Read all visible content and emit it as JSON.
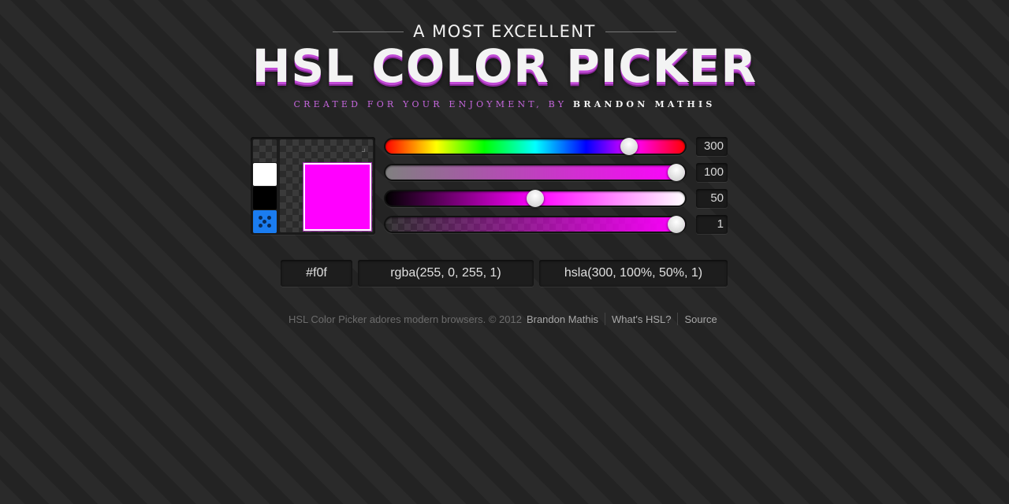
{
  "header": {
    "eyebrow": "A MOST EXCELLENT",
    "title": "HSL COLOR PICKER",
    "byline_lead": "CREATED FOR YOUR ENJOYMENT, BY",
    "byline_author": "BRANDON MATHIS"
  },
  "picker": {
    "current_color": "#ff00ff",
    "swatches": [
      "transparent",
      "#ffffff",
      "#000000",
      "random"
    ],
    "sliders": {
      "hue": {
        "value": "300",
        "fraction": 0.833
      },
      "saturation": {
        "value": "100",
        "fraction": 1.0
      },
      "lightness": {
        "value": "50",
        "fraction": 0.5
      },
      "alpha": {
        "value": "1",
        "fraction": 1.0
      }
    }
  },
  "outputs": {
    "hex": "#f0f",
    "rgba": "rgba(255, 0, 255, 1)",
    "hsla": "hsla(300, 100%, 50%, 1)"
  },
  "footer": {
    "text": "HSL Color Picker adores modern browsers. © 2012",
    "links": [
      "Brandon Mathis",
      "What's HSL?",
      "Source"
    ]
  }
}
